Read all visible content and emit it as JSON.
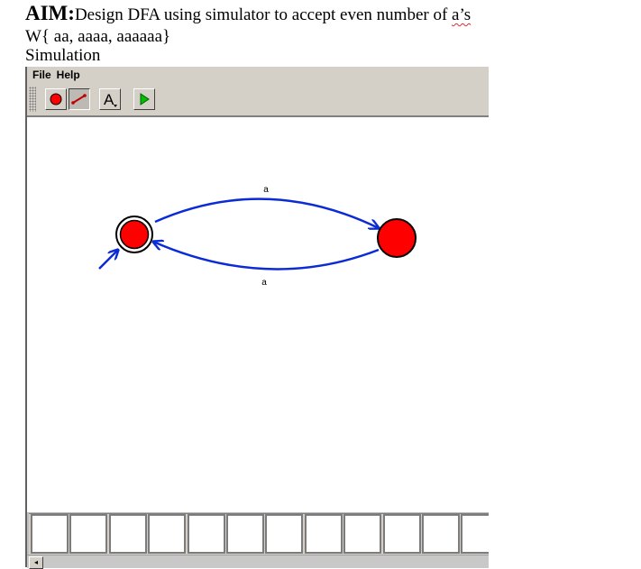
{
  "document": {
    "aim_label": "AIM:",
    "aim_text_before": "Design DFA  using simulator to  accept even number of ",
    "aim_text_flagged": "a’s",
    "language_line": "W{ aa, aaaa, aaaaaa}",
    "section_heading": "Simulation"
  },
  "menubar": {
    "file_label": "File",
    "help_label": "Help"
  },
  "toolbar": {
    "tools": [
      "state-tool-icon",
      "transition-tool-icon",
      "text-tool-icon",
      "run-icon"
    ],
    "active_tool": "transition-tool-icon"
  },
  "diagram": {
    "states": [
      "q0",
      "q1"
    ],
    "start_state": "q0",
    "accepting_states": [
      "q0"
    ],
    "transitions": [
      {
        "from": "q0",
        "to": "q1",
        "label": "a"
      },
      {
        "from": "q1",
        "to": "q0",
        "label": "a"
      }
    ],
    "state_color": "#ff0000",
    "edge_color": "#0b2bd6"
  },
  "tape": {
    "cells": [
      "",
      "",
      "",
      "",
      "",
      "",
      "",
      "",
      "",
      "",
      "",
      "",
      ""
    ]
  },
  "scrollbar": {
    "left_arrow_icon": "◂"
  }
}
